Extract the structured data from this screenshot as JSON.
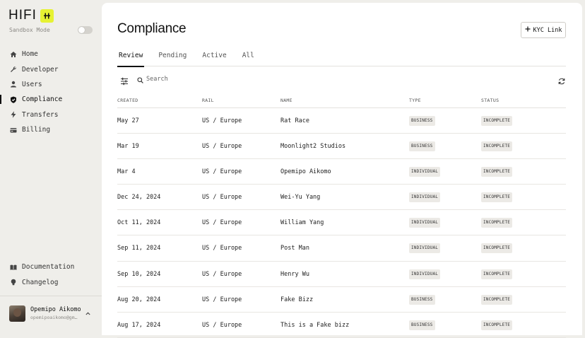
{
  "app": {
    "logo_text": "HIFI",
    "sandbox_label": "Sandbox Mode",
    "accent_color": "#e6f233"
  },
  "sidebar": {
    "items": [
      {
        "label": "Home",
        "icon": "home-icon"
      },
      {
        "label": "Developer",
        "icon": "wrench-icon"
      },
      {
        "label": "Users",
        "icon": "user-icon"
      },
      {
        "label": "Compliance",
        "icon": "shield-icon",
        "active": true
      },
      {
        "label": "Transfers",
        "icon": "lightning-icon"
      },
      {
        "label": "Billing",
        "icon": "card-icon"
      }
    ],
    "bottom_items": [
      {
        "label": "Documentation",
        "icon": "book-icon"
      },
      {
        "label": "Changelog",
        "icon": "bulb-icon"
      }
    ],
    "user": {
      "name": "Opemipo Aikomo",
      "email": "opemipoaikomo@gm…"
    }
  },
  "main": {
    "title": "Compliance",
    "kyc_button_label": "KYC Link",
    "tabs": [
      {
        "label": "Review",
        "active": true
      },
      {
        "label": "Pending"
      },
      {
        "label": "Active"
      },
      {
        "label": "All"
      }
    ],
    "search_placeholder": "Search",
    "columns": [
      "CREATED",
      "RAIL",
      "NAME",
      "TYPE",
      "STATUS"
    ],
    "rows": [
      {
        "created": "May 27",
        "rail": "US / Europe",
        "name": "Rat Race",
        "type": "BUSINESS",
        "status": "INCOMPLETE"
      },
      {
        "created": "Mar 19",
        "rail": "US / Europe",
        "name": "Moonlight2 Studios",
        "type": "BUSINESS",
        "status": "INCOMPLETE"
      },
      {
        "created": "Mar 4",
        "rail": "US / Europe",
        "name": "Opemipo Aikomo",
        "type": "INDIVIDUAL",
        "status": "INCOMPLETE"
      },
      {
        "created": "Dec 24, 2024",
        "rail": "US / Europe",
        "name": "Wei-Yu Yang",
        "type": "INDIVIDUAL",
        "status": "INCOMPLETE"
      },
      {
        "created": "Oct 11, 2024",
        "rail": "US / Europe",
        "name": "William Yang",
        "type": "INDIVIDUAL",
        "status": "INCOMPLETE"
      },
      {
        "created": "Sep 11, 2024",
        "rail": "US / Europe",
        "name": "Post Man",
        "type": "INDIVIDUAL",
        "status": "INCOMPLETE"
      },
      {
        "created": "Sep 10, 2024",
        "rail": "US / Europe",
        "name": "Henry Wu",
        "type": "INDIVIDUAL",
        "status": "INCOMPLETE"
      },
      {
        "created": "Aug 20, 2024",
        "rail": "US / Europe",
        "name": "Fake Bizz",
        "type": "BUSINESS",
        "status": "INCOMPLETE"
      },
      {
        "created": "Aug 17, 2024",
        "rail": "US / Europe",
        "name": "This is a Fake bizz",
        "type": "BUSINESS",
        "status": "INCOMPLETE"
      }
    ]
  }
}
